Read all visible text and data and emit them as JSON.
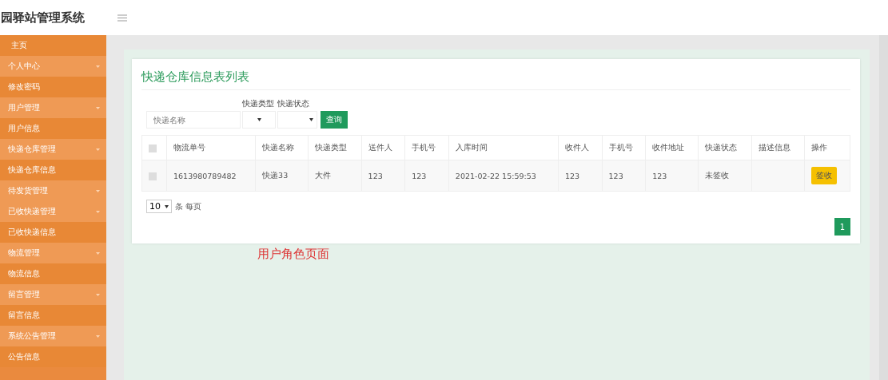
{
  "header": {
    "title": "园驿站管理系统"
  },
  "sidebar": {
    "items": [
      {
        "label": "主页",
        "kind": "link"
      },
      {
        "label": "个人中心",
        "kind": "group"
      },
      {
        "label": "修改密码",
        "kind": "link"
      },
      {
        "label": "用户管理",
        "kind": "group"
      },
      {
        "label": "用户信息",
        "kind": "link"
      },
      {
        "label": "快递仓库管理",
        "kind": "group"
      },
      {
        "label": "快递仓库信息",
        "kind": "link"
      },
      {
        "label": "待发货管理",
        "kind": "group"
      },
      {
        "label": "已收快递管理",
        "kind": "group"
      },
      {
        "label": "已收快递信息",
        "kind": "link"
      },
      {
        "label": "物流管理",
        "kind": "group"
      },
      {
        "label": "物流信息",
        "kind": "link"
      },
      {
        "label": "留言管理",
        "kind": "group"
      },
      {
        "label": "留言信息",
        "kind": "link"
      },
      {
        "label": "系统公告管理",
        "kind": "group"
      },
      {
        "label": "公告信息",
        "kind": "link"
      }
    ]
  },
  "card": {
    "title": "快递仓库信息表列表",
    "filters": {
      "name_placeholder": "快递名称",
      "type_label": "快递类型",
      "status_label": "快递状态",
      "search_button": "查询"
    },
    "table": {
      "header_checked": false,
      "columns": [
        "物流单号",
        "快递名称",
        "快递类型",
        "送件人",
        "手机号",
        "入库时间",
        "收件人",
        "手机号",
        "收件地址",
        "快递状态",
        "描述信息",
        "操作"
      ],
      "rows": [
        {
          "checked": false,
          "cells": [
            "1613980789482",
            "快递33",
            "大件",
            "123",
            "123",
            "2021-02-22 15:59:53",
            "123",
            "123",
            "123",
            "未签收",
            ""
          ],
          "action": "签收"
        }
      ]
    },
    "page_size": {
      "value": "10",
      "suffix": "条 每页"
    },
    "pages": [
      {
        "label": "1",
        "selected": true
      }
    ]
  },
  "annotation": "用户角色页面"
}
